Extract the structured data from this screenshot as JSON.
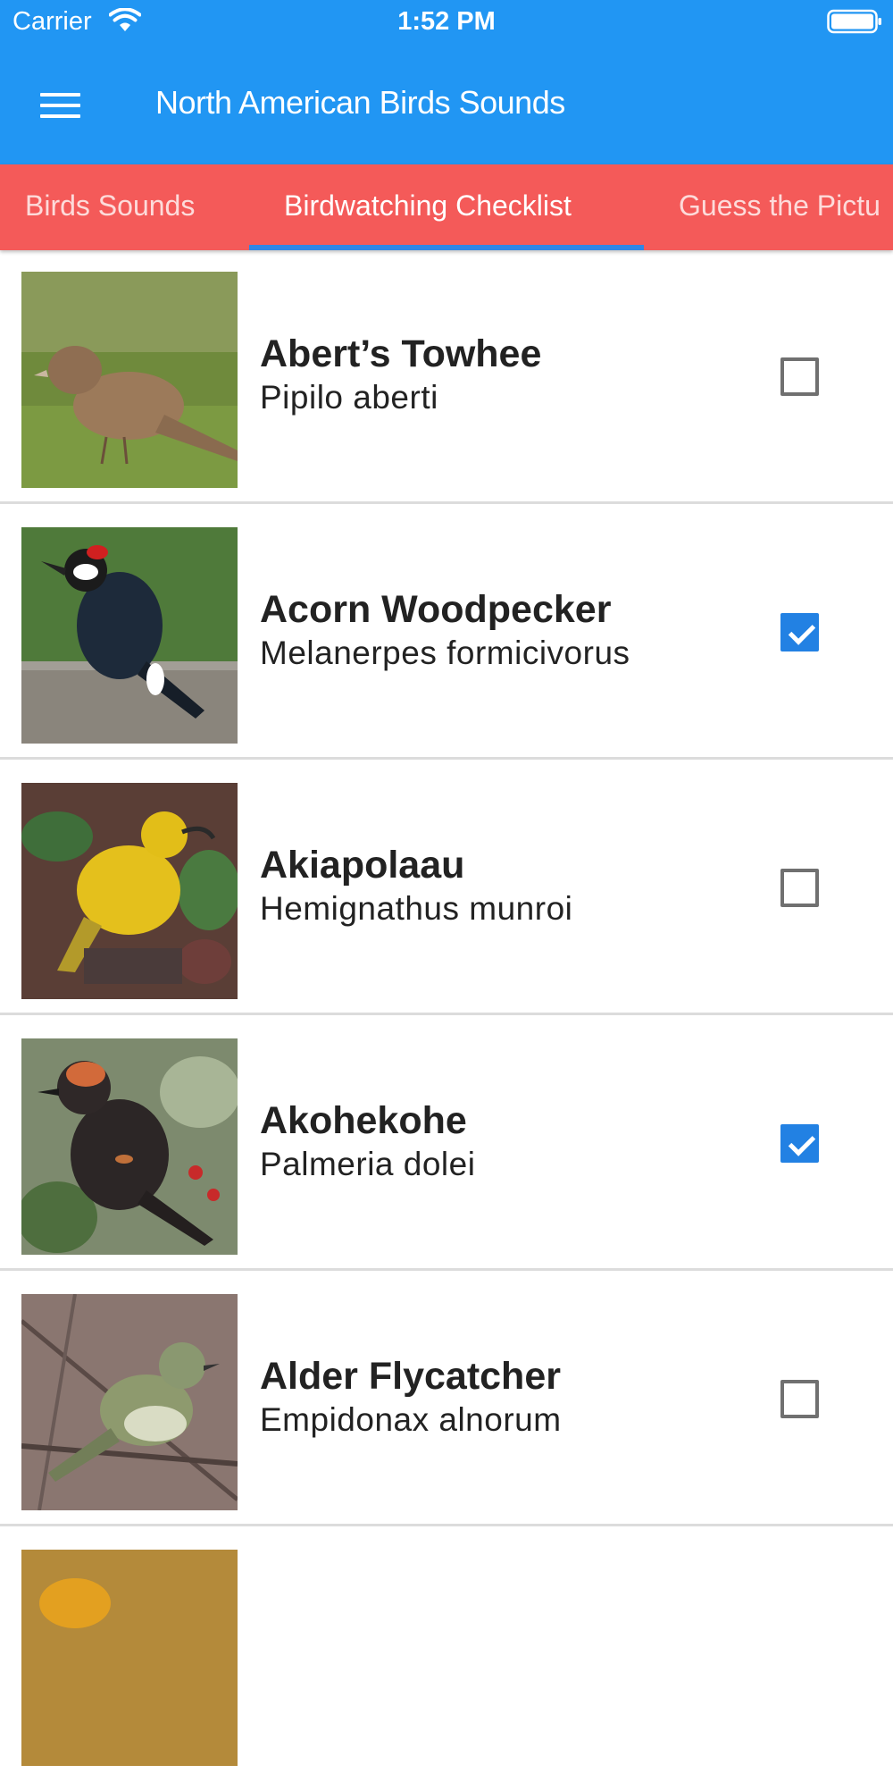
{
  "status_bar": {
    "carrier": "Carrier",
    "time": "1:52 PM"
  },
  "app_bar": {
    "title": "North American Birds Sounds",
    "menu_icon": "hamburger-menu-icon"
  },
  "tabs": [
    {
      "label": "Birds Sounds",
      "active": false
    },
    {
      "label": "Birdwatching Checklist",
      "active": true
    },
    {
      "label": "Guess the Pictu",
      "active": false
    }
  ],
  "colors": {
    "primary": "#2196f3",
    "tab_bar": "#f45a59",
    "indicator": "#2f86e6",
    "checkbox_checked": "#2281e3"
  },
  "birds": [
    {
      "name": "Abert’s Towhee",
      "scientific": "Pipilo aberti",
      "checked": false
    },
    {
      "name": "Acorn Woodpecker",
      "scientific": "Melanerpes formicivorus",
      "checked": true
    },
    {
      "name": "Akiapolaau",
      "scientific": "Hemignathus munroi",
      "checked": false
    },
    {
      "name": "Akohekohe",
      "scientific": "Palmeria dolei",
      "checked": true
    },
    {
      "name": "Alder Flycatcher",
      "scientific": "Empidonax alnorum",
      "checked": false
    }
  ]
}
